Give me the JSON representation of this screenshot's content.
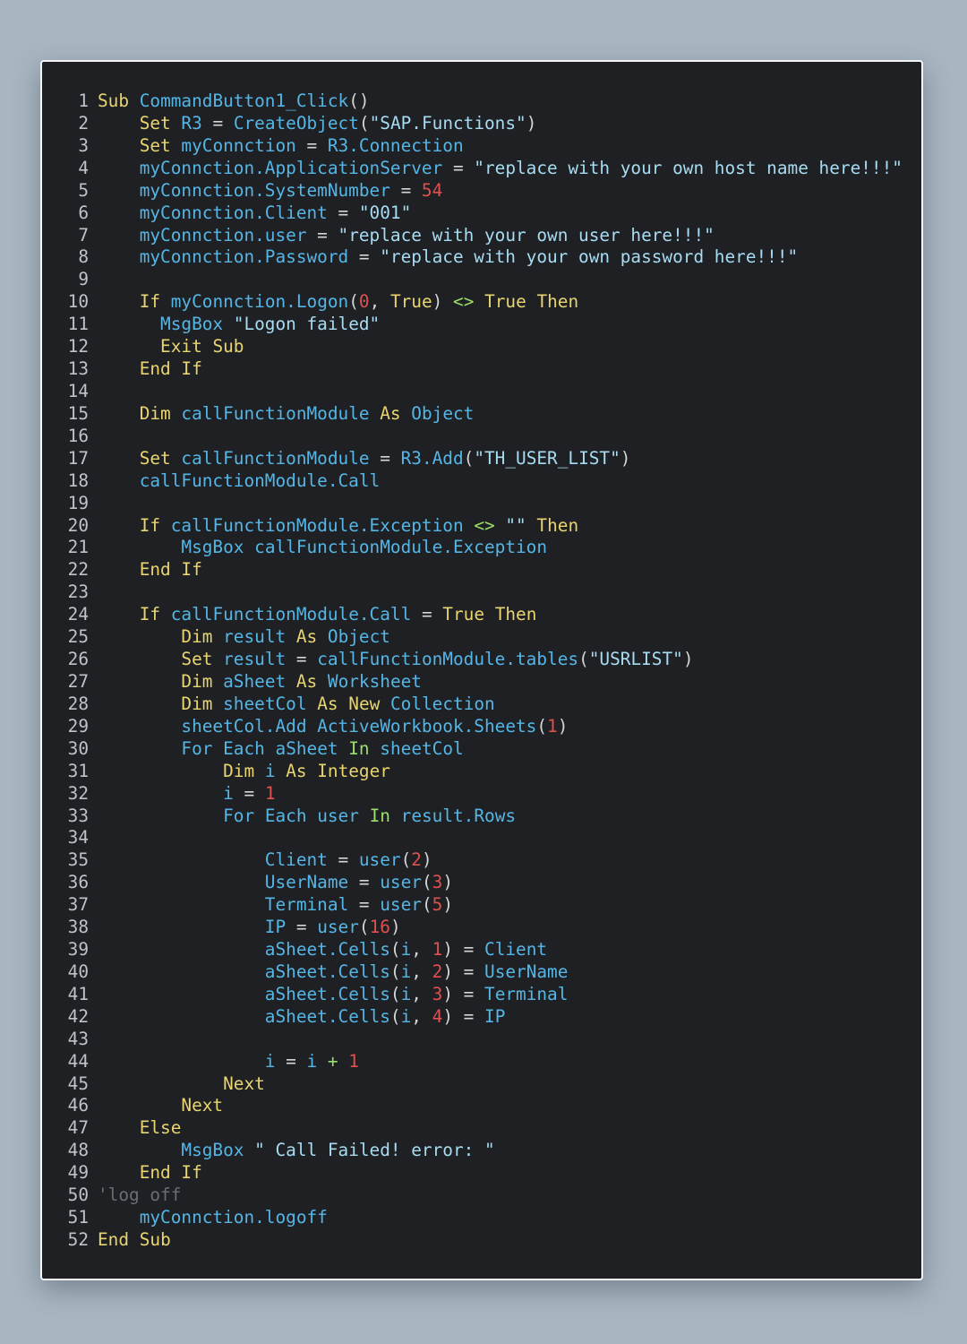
{
  "code_lines": [
    {
      "n": "1",
      "tokens": [
        [
          "kw",
          "Sub"
        ],
        [
          "op",
          " "
        ],
        [
          "id",
          "CommandButton1_Click"
        ],
        [
          "op",
          "()"
        ]
      ]
    },
    {
      "n": "2",
      "tokens": [
        [
          "op",
          "    "
        ],
        [
          "kw",
          "Set"
        ],
        [
          "op",
          " "
        ],
        [
          "id",
          "R3"
        ],
        [
          "op",
          " = "
        ],
        [
          "id",
          "CreateObject"
        ],
        [
          "op",
          "("
        ],
        [
          "st",
          "\"SAP.Functions\""
        ],
        [
          "op",
          ")"
        ]
      ]
    },
    {
      "n": "3",
      "tokens": [
        [
          "op",
          "    "
        ],
        [
          "kw",
          "Set"
        ],
        [
          "op",
          " "
        ],
        [
          "id",
          "myConnction"
        ],
        [
          "op",
          " = "
        ],
        [
          "id",
          "R3.Connection"
        ]
      ]
    },
    {
      "n": "4",
      "tokens": [
        [
          "op",
          "    "
        ],
        [
          "id",
          "myConnction.ApplicationServer"
        ],
        [
          "op",
          " = "
        ],
        [
          "st",
          "\"replace with your own host name here!!!\""
        ]
      ]
    },
    {
      "n": "5",
      "tokens": [
        [
          "op",
          "    "
        ],
        [
          "id",
          "myConnction.SystemNumber"
        ],
        [
          "op",
          " = "
        ],
        [
          "nu",
          "54"
        ]
      ]
    },
    {
      "n": "6",
      "tokens": [
        [
          "op",
          "    "
        ],
        [
          "id",
          "myConnction.Client"
        ],
        [
          "op",
          " = "
        ],
        [
          "st",
          "\"001\""
        ]
      ]
    },
    {
      "n": "7",
      "tokens": [
        [
          "op",
          "    "
        ],
        [
          "id",
          "myConnction.user"
        ],
        [
          "op",
          " = "
        ],
        [
          "st",
          "\"replace with your own user here!!!\""
        ]
      ]
    },
    {
      "n": "8",
      "tokens": [
        [
          "op",
          "    "
        ],
        [
          "id",
          "myConnction.Password"
        ],
        [
          "op",
          " = "
        ],
        [
          "st",
          "\"replace with your own password here!!!\""
        ]
      ]
    },
    {
      "n": "9",
      "tokens": []
    },
    {
      "n": "10",
      "tokens": [
        [
          "op",
          "    "
        ],
        [
          "kw",
          "If"
        ],
        [
          "op",
          " "
        ],
        [
          "id",
          "myConnction.Logon"
        ],
        [
          "op",
          "("
        ],
        [
          "nu",
          "0"
        ],
        [
          "op",
          ", "
        ],
        [
          "kw",
          "True"
        ],
        [
          "op",
          ") "
        ],
        [
          "og",
          "<>"
        ],
        [
          "op",
          " "
        ],
        [
          "kw",
          "True"
        ],
        [
          "op",
          " "
        ],
        [
          "kw",
          "Then"
        ]
      ]
    },
    {
      "n": "11",
      "tokens": [
        [
          "op",
          "      "
        ],
        [
          "id",
          "MsgBox"
        ],
        [
          "op",
          " "
        ],
        [
          "st",
          "\"Logon failed\""
        ]
      ]
    },
    {
      "n": "12",
      "tokens": [
        [
          "op",
          "      "
        ],
        [
          "kw",
          "Exit"
        ],
        [
          "op",
          " "
        ],
        [
          "kw",
          "Sub"
        ]
      ]
    },
    {
      "n": "13",
      "tokens": [
        [
          "op",
          "    "
        ],
        [
          "kw",
          "End"
        ],
        [
          "op",
          " "
        ],
        [
          "kw",
          "If"
        ]
      ]
    },
    {
      "n": "14",
      "tokens": []
    },
    {
      "n": "15",
      "tokens": [
        [
          "op",
          "    "
        ],
        [
          "kw",
          "Dim"
        ],
        [
          "op",
          " "
        ],
        [
          "id",
          "callFunctionModule"
        ],
        [
          "op",
          " "
        ],
        [
          "kw",
          "As"
        ],
        [
          "op",
          " "
        ],
        [
          "id",
          "Object"
        ]
      ]
    },
    {
      "n": "16",
      "tokens": []
    },
    {
      "n": "17",
      "tokens": [
        [
          "op",
          "    "
        ],
        [
          "kw",
          "Set"
        ],
        [
          "op",
          " "
        ],
        [
          "id",
          "callFunctionModule"
        ],
        [
          "op",
          " = "
        ],
        [
          "id",
          "R3.Add"
        ],
        [
          "op",
          "("
        ],
        [
          "st",
          "\"TH_USER_LIST\""
        ],
        [
          "op",
          ")"
        ]
      ]
    },
    {
      "n": "18",
      "tokens": [
        [
          "op",
          "    "
        ],
        [
          "id",
          "callFunctionModule.Call"
        ]
      ]
    },
    {
      "n": "19",
      "tokens": []
    },
    {
      "n": "20",
      "tokens": [
        [
          "op",
          "    "
        ],
        [
          "kw",
          "If"
        ],
        [
          "op",
          " "
        ],
        [
          "id",
          "callFunctionModule.Exception"
        ],
        [
          "op",
          " "
        ],
        [
          "og",
          "<>"
        ],
        [
          "op",
          " "
        ],
        [
          "st",
          "\"\""
        ],
        [
          "op",
          " "
        ],
        [
          "kw",
          "Then"
        ]
      ]
    },
    {
      "n": "21",
      "tokens": [
        [
          "op",
          "        "
        ],
        [
          "id",
          "MsgBox"
        ],
        [
          "op",
          " "
        ],
        [
          "id",
          "callFunctionModule.Exception"
        ]
      ]
    },
    {
      "n": "22",
      "tokens": [
        [
          "op",
          "    "
        ],
        [
          "kw",
          "End"
        ],
        [
          "op",
          " "
        ],
        [
          "kw",
          "If"
        ]
      ]
    },
    {
      "n": "23",
      "tokens": []
    },
    {
      "n": "24",
      "tokens": [
        [
          "op",
          "    "
        ],
        [
          "kw",
          "If"
        ],
        [
          "op",
          " "
        ],
        [
          "id",
          "callFunctionModule.Call"
        ],
        [
          "op",
          " = "
        ],
        [
          "kw",
          "True"
        ],
        [
          "op",
          " "
        ],
        [
          "kw",
          "Then"
        ]
      ]
    },
    {
      "n": "25",
      "tokens": [
        [
          "op",
          "        "
        ],
        [
          "kw",
          "Dim"
        ],
        [
          "op",
          " "
        ],
        [
          "id",
          "result"
        ],
        [
          "op",
          " "
        ],
        [
          "kw",
          "As"
        ],
        [
          "op",
          " "
        ],
        [
          "id",
          "Object"
        ]
      ]
    },
    {
      "n": "26",
      "tokens": [
        [
          "op",
          "        "
        ],
        [
          "kw",
          "Set"
        ],
        [
          "op",
          " "
        ],
        [
          "id",
          "result"
        ],
        [
          "op",
          " = "
        ],
        [
          "id",
          "callFunctionModule.tables"
        ],
        [
          "op",
          "("
        ],
        [
          "st",
          "\"USRLIST\""
        ],
        [
          "op",
          ")"
        ]
      ]
    },
    {
      "n": "27",
      "tokens": [
        [
          "op",
          "        "
        ],
        [
          "kw",
          "Dim"
        ],
        [
          "op",
          " "
        ],
        [
          "id",
          "aSheet"
        ],
        [
          "op",
          " "
        ],
        [
          "kw",
          "As"
        ],
        [
          "op",
          " "
        ],
        [
          "id",
          "Worksheet"
        ]
      ]
    },
    {
      "n": "28",
      "tokens": [
        [
          "op",
          "        "
        ],
        [
          "kw",
          "Dim"
        ],
        [
          "op",
          " "
        ],
        [
          "id",
          "sheetCol"
        ],
        [
          "op",
          " "
        ],
        [
          "kw",
          "As"
        ],
        [
          "op",
          " "
        ],
        [
          "kw",
          "New"
        ],
        [
          "op",
          " "
        ],
        [
          "id",
          "Collection"
        ]
      ]
    },
    {
      "n": "29",
      "tokens": [
        [
          "op",
          "        "
        ],
        [
          "id",
          "sheetCol.Add"
        ],
        [
          "op",
          " "
        ],
        [
          "id",
          "ActiveWorkbook.Sheets"
        ],
        [
          "op",
          "("
        ],
        [
          "nu",
          "1"
        ],
        [
          "op",
          ")"
        ]
      ]
    },
    {
      "n": "30",
      "tokens": [
        [
          "op",
          "        "
        ],
        [
          "id",
          "For"
        ],
        [
          "op",
          " "
        ],
        [
          "id",
          "Each"
        ],
        [
          "op",
          " "
        ],
        [
          "id",
          "aSheet"
        ],
        [
          "op",
          " "
        ],
        [
          "og",
          "In"
        ],
        [
          "op",
          " "
        ],
        [
          "id",
          "sheetCol"
        ]
      ]
    },
    {
      "n": "31",
      "tokens": [
        [
          "op",
          "            "
        ],
        [
          "kw",
          "Dim"
        ],
        [
          "op",
          " "
        ],
        [
          "id",
          "i"
        ],
        [
          "op",
          " "
        ],
        [
          "kw",
          "As"
        ],
        [
          "op",
          " "
        ],
        [
          "kw",
          "Integer"
        ]
      ]
    },
    {
      "n": "32",
      "tokens": [
        [
          "op",
          "            "
        ],
        [
          "id",
          "i"
        ],
        [
          "op",
          " = "
        ],
        [
          "nu",
          "1"
        ]
      ]
    },
    {
      "n": "33",
      "tokens": [
        [
          "op",
          "            "
        ],
        [
          "id",
          "For"
        ],
        [
          "op",
          " "
        ],
        [
          "id",
          "Each"
        ],
        [
          "op",
          " "
        ],
        [
          "id",
          "user"
        ],
        [
          "op",
          " "
        ],
        [
          "og",
          "In"
        ],
        [
          "op",
          " "
        ],
        [
          "id",
          "result.Rows"
        ]
      ]
    },
    {
      "n": "34",
      "tokens": []
    },
    {
      "n": "35",
      "tokens": [
        [
          "op",
          "                "
        ],
        [
          "id",
          "Client"
        ],
        [
          "op",
          " = "
        ],
        [
          "id",
          "user"
        ],
        [
          "op",
          "("
        ],
        [
          "nu",
          "2"
        ],
        [
          "op",
          ")"
        ]
      ]
    },
    {
      "n": "36",
      "tokens": [
        [
          "op",
          "                "
        ],
        [
          "id",
          "UserName"
        ],
        [
          "op",
          " = "
        ],
        [
          "id",
          "user"
        ],
        [
          "op",
          "("
        ],
        [
          "nu",
          "3"
        ],
        [
          "op",
          ")"
        ]
      ]
    },
    {
      "n": "37",
      "tokens": [
        [
          "op",
          "                "
        ],
        [
          "id",
          "Terminal"
        ],
        [
          "op",
          " = "
        ],
        [
          "id",
          "user"
        ],
        [
          "op",
          "("
        ],
        [
          "nu",
          "5"
        ],
        [
          "op",
          ")"
        ]
      ]
    },
    {
      "n": "38",
      "tokens": [
        [
          "op",
          "                "
        ],
        [
          "id",
          "IP"
        ],
        [
          "op",
          " = "
        ],
        [
          "id",
          "user"
        ],
        [
          "op",
          "("
        ],
        [
          "nu",
          "16"
        ],
        [
          "op",
          ")"
        ]
      ]
    },
    {
      "n": "39",
      "tokens": [
        [
          "op",
          "                "
        ],
        [
          "id",
          "aSheet.Cells"
        ],
        [
          "op",
          "("
        ],
        [
          "id",
          "i"
        ],
        [
          "op",
          ", "
        ],
        [
          "nu",
          "1"
        ],
        [
          "op",
          ") = "
        ],
        [
          "id",
          "Client"
        ]
      ]
    },
    {
      "n": "40",
      "tokens": [
        [
          "op",
          "                "
        ],
        [
          "id",
          "aSheet.Cells"
        ],
        [
          "op",
          "("
        ],
        [
          "id",
          "i"
        ],
        [
          "op",
          ", "
        ],
        [
          "nu",
          "2"
        ],
        [
          "op",
          ") = "
        ],
        [
          "id",
          "UserName"
        ]
      ]
    },
    {
      "n": "41",
      "tokens": [
        [
          "op",
          "                "
        ],
        [
          "id",
          "aSheet.Cells"
        ],
        [
          "op",
          "("
        ],
        [
          "id",
          "i"
        ],
        [
          "op",
          ", "
        ],
        [
          "nu",
          "3"
        ],
        [
          "op",
          ") = "
        ],
        [
          "id",
          "Terminal"
        ]
      ]
    },
    {
      "n": "42",
      "tokens": [
        [
          "op",
          "                "
        ],
        [
          "id",
          "aSheet.Cells"
        ],
        [
          "op",
          "("
        ],
        [
          "id",
          "i"
        ],
        [
          "op",
          ", "
        ],
        [
          "nu",
          "4"
        ],
        [
          "op",
          ") = "
        ],
        [
          "id",
          "IP"
        ]
      ]
    },
    {
      "n": "43",
      "tokens": []
    },
    {
      "n": "44",
      "tokens": [
        [
          "op",
          "                "
        ],
        [
          "id",
          "i"
        ],
        [
          "op",
          " = "
        ],
        [
          "id",
          "i"
        ],
        [
          "op",
          " "
        ],
        [
          "og",
          "+"
        ],
        [
          "op",
          " "
        ],
        [
          "nu",
          "1"
        ]
      ]
    },
    {
      "n": "45",
      "tokens": [
        [
          "op",
          "            "
        ],
        [
          "kw",
          "Next"
        ]
      ]
    },
    {
      "n": "46",
      "tokens": [
        [
          "op",
          "        "
        ],
        [
          "kw",
          "Next"
        ]
      ]
    },
    {
      "n": "47",
      "tokens": [
        [
          "op",
          "    "
        ],
        [
          "kw",
          "Else"
        ]
      ]
    },
    {
      "n": "48",
      "tokens": [
        [
          "op",
          "        "
        ],
        [
          "id",
          "MsgBox"
        ],
        [
          "op",
          " "
        ],
        [
          "st",
          "\" Call Failed! error: \""
        ]
      ]
    },
    {
      "n": "49",
      "tokens": [
        [
          "op",
          "    "
        ],
        [
          "kw",
          "End"
        ],
        [
          "op",
          " "
        ],
        [
          "kw",
          "If"
        ]
      ]
    },
    {
      "n": "50",
      "tokens": [
        [
          "cm",
          "'log off"
        ]
      ]
    },
    {
      "n": "51",
      "tokens": [
        [
          "op",
          "    "
        ],
        [
          "id",
          "myConnction.logoff"
        ]
      ]
    },
    {
      "n": "52",
      "tokens": [
        [
          "kw",
          "End"
        ],
        [
          "op",
          " "
        ],
        [
          "kw",
          "Sub"
        ]
      ]
    }
  ]
}
